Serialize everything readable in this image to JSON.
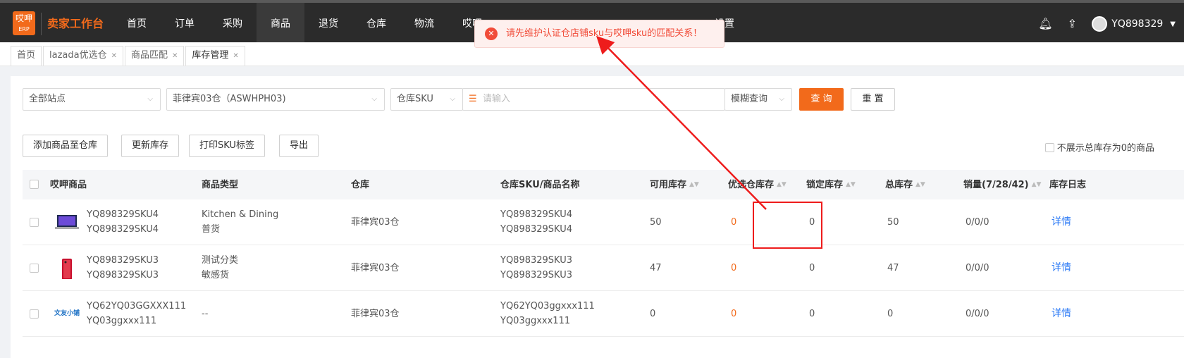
{
  "header": {
    "logo_text": "哎呷",
    "logo_sub": "ERP",
    "brand": "卖家工作台",
    "nav": [
      "首页",
      "订单",
      "采购",
      "商品",
      "退货",
      "仓库",
      "物流",
      "哎呷",
      "设置"
    ],
    "user": "YQ898329"
  },
  "tabs": [
    {
      "label": "首页",
      "closable": false
    },
    {
      "label": "lazada优选仓",
      "closable": true
    },
    {
      "label": "商品匹配",
      "closable": true
    },
    {
      "label": "库存管理",
      "closable": true
    }
  ],
  "filters": {
    "site": "全部站点",
    "warehouse": "菲律宾03仓（ASWHPH03)",
    "sku_type": "仓库SKU",
    "search_placeholder": "请输入",
    "match_mode": "模糊查询",
    "query": "查 询",
    "reset": "重 置"
  },
  "actions": [
    "添加商品至仓库",
    "更新库存",
    "打印SKU标签",
    "导出"
  ],
  "hide_zero_label": "不展示总库存为0的商品",
  "columns": [
    "哎呷商品",
    "商品类型",
    "仓库",
    "仓库SKU/商品名称",
    "可用库存",
    "优选仓库存",
    "锁定库存",
    "总库存",
    "销量(7/28/42)",
    "库存日志"
  ],
  "rows": [
    {
      "sku1": "YQ898329SKU4",
      "sku2": "YQ898329SKU4",
      "type1": "Kitchen & Dining",
      "type2": "普货",
      "warehouse": "菲律宾03仓",
      "wsku1": "YQ898329SKU4",
      "wsku2": "YQ898329SKU4",
      "available": "50",
      "preferred": "0",
      "locked": "0",
      "total": "50",
      "sales": "0/0/0",
      "log": "详情"
    },
    {
      "sku1": "YQ898329SKU3",
      "sku2": "YQ898329SKU3",
      "type1": "测试分类",
      "type2": "敏感货",
      "warehouse": "菲律宾03仓",
      "wsku1": "YQ898329SKU3",
      "wsku2": "YQ898329SKU3",
      "available": "47",
      "preferred": "0",
      "locked": "0",
      "total": "47",
      "sales": "0/0/0",
      "log": "详情"
    },
    {
      "sku1": "YQ62YQ03GGXXX111",
      "sku2": "YQ03ggxxx111",
      "type1": "--",
      "type2": "",
      "warehouse": "菲律宾03仓",
      "wsku1": "YQ62YQ03ggxxx111",
      "wsku2": "YQ03ggxxx111",
      "available": "0",
      "preferred": "0",
      "locked": "0",
      "total": "0",
      "sales": "0/0/0",
      "log": "详情"
    }
  ],
  "toast": "请先维护认证仓店铺sku与哎呷sku的匹配关系！",
  "third_thumb_text": "文友小铺"
}
